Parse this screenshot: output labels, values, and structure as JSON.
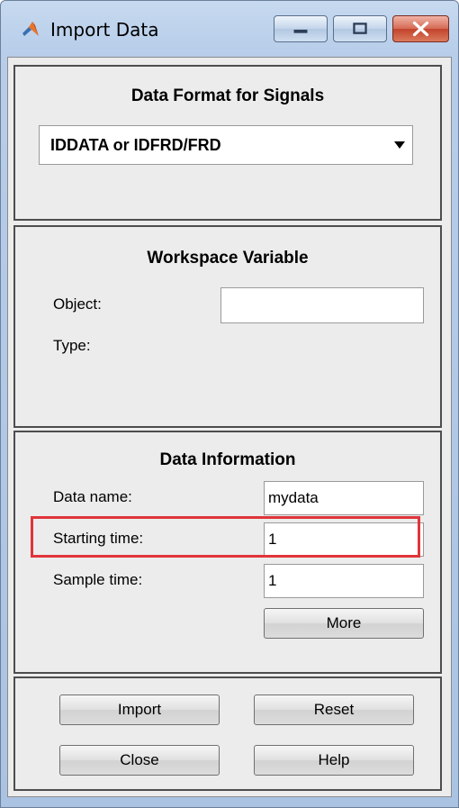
{
  "window": {
    "title": "Import Data",
    "icon": "matlab-logo-icon"
  },
  "format_panel": {
    "title": "Data Format for Signals",
    "selected_format": "IDDATA or IDFRD/FRD"
  },
  "workspace_panel": {
    "title": "Workspace Variable",
    "object_label": "Object:",
    "object_value": "",
    "type_label": "Type:"
  },
  "info_panel": {
    "title": "Data Information",
    "data_name_label": "Data name:",
    "data_name_value": "mydata",
    "starting_time_label": "Starting time:",
    "starting_time_value": "1",
    "sample_time_label": "Sample time:",
    "sample_time_value": "1",
    "more_label": "More"
  },
  "actions": {
    "import_label": "Import",
    "reset_label": "Reset",
    "close_label": "Close",
    "help_label": "Help"
  },
  "colors": {
    "highlight": "#e0353a",
    "panel_bg": "#ececec",
    "titlebar": "#b7cde9"
  }
}
